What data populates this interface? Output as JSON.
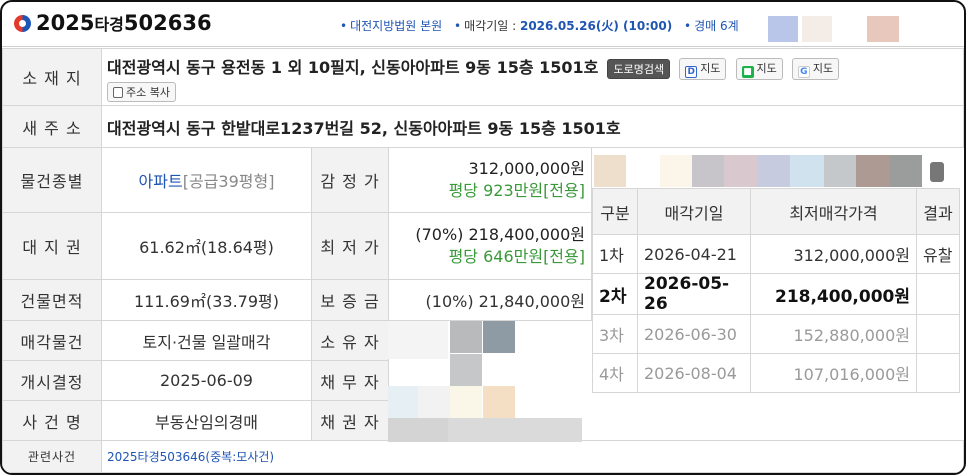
{
  "header": {
    "case_prefix": "2025",
    "case_type": "타경",
    "case_number": "502636",
    "court": "대전지방법원 본원",
    "sale_date_label": "매각기일 : ",
    "sale_date": "2026.05.26(火) (10:00)",
    "auction_dept": "경매 6계"
  },
  "labels": {
    "location": "소 재 지",
    "new_address": "새 주 소",
    "property_type": "물건종별",
    "land_right": "대 지 권",
    "building_area": "건물면적",
    "sale_object": "매각물건",
    "start_decision": "개시결정",
    "case_name": "사 건 명",
    "related_case": "관련사건",
    "appraisal": "감 정 가",
    "minimum": "최 저 가",
    "deposit": "보 증 금",
    "owner": "소 유 자",
    "debtor": "채 무 자",
    "creditor": "채 권 자"
  },
  "values": {
    "location": "대전광역시 동구 용전동 1 외 10필지, 신동아아파트 9동 15층 1501호",
    "new_address": "대전광역시 동구 한밭대로1237번길 52, 신동아아파트 9동 15층 1501호",
    "property_type": "아파트",
    "property_size": "[공급39평형]",
    "land_right": "61.62㎡(18.64평)",
    "building_area": "111.69㎡(33.79평)",
    "sale_object": "토지·건물 일괄매각",
    "start_decision": "2025-06-09",
    "case_name": "부동산임의경매",
    "related_case": "2025타경503646(중복:모사건)",
    "appraisal": "312,000,000원",
    "appraisal_per": "평당 923만원[전용]",
    "minimum": "(70%) 218,400,000원",
    "minimum_per": "평당 646만원[전용]",
    "deposit": "(10%) 21,840,000원"
  },
  "buttons": {
    "road_search": "도로명검색",
    "map_daum": "지도",
    "map_naver": "지도",
    "map_google": "지도",
    "copy_address": "주소 복사"
  },
  "auction_table": {
    "headers": [
      "구분",
      "매각기일",
      "최저매각가격",
      "결과"
    ],
    "rows": [
      {
        "round": "1차",
        "date": "2026-04-21",
        "price": "312,000,000원",
        "result": "유찰"
      },
      {
        "round": "2차",
        "date": "2026-05-26",
        "price": "218,400,000원",
        "result": ""
      },
      {
        "round": "3차",
        "date": "2026-06-30",
        "price": "152,880,000원",
        "result": ""
      },
      {
        "round": "4차",
        "date": "2026-08-04",
        "price": "107,016,000원",
        "result": ""
      }
    ]
  }
}
